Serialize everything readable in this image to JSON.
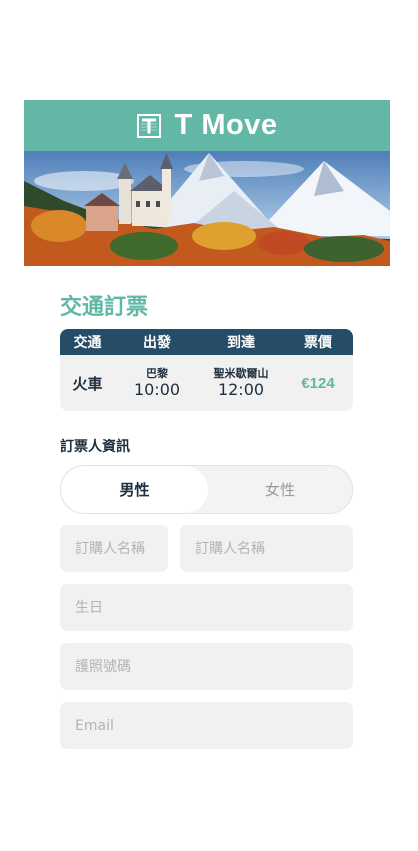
{
  "header": {
    "title": "T Move",
    "logo_icon": "t-logo-icon",
    "background": "#63b7a6"
  },
  "hero": {
    "image": "castle-mountain-landscape"
  },
  "booking": {
    "section_title": "交通訂票",
    "table": {
      "headers": [
        "交通",
        "出發",
        "到達",
        "票價"
      ],
      "row": {
        "mode": "火車",
        "depart_place": "巴黎",
        "depart_time": "10:00",
        "arrive_place": "聖米歇爾山",
        "arrive_time": "12:00",
        "price": "€124"
      }
    }
  },
  "passenger": {
    "section_title": "訂票人資訊",
    "gender": {
      "male": "男性",
      "female": "女性",
      "selected": "male"
    },
    "first_name": {
      "placeholder": "訂購人名稱",
      "value": ""
    },
    "last_name": {
      "placeholder": "訂購人名稱",
      "value": ""
    },
    "birthday": {
      "placeholder": "生日",
      "value": ""
    },
    "passport": {
      "placeholder": "護照號碼",
      "value": ""
    },
    "email": {
      "placeholder": "Email",
      "value": ""
    }
  },
  "colors": {
    "accent": "#5fb7a6",
    "table_header": "#264d67",
    "field_bg": "#f1f1f1"
  }
}
